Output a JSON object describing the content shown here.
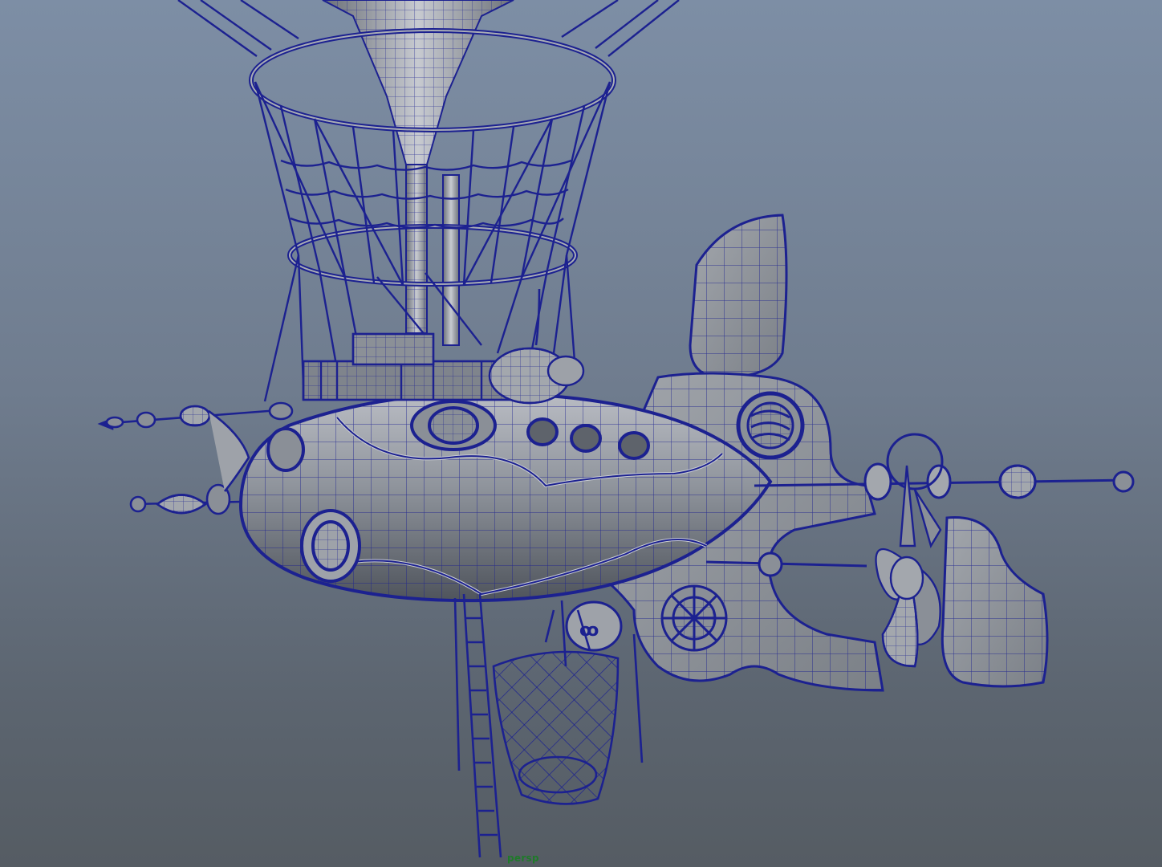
{
  "viewport": {
    "camera_label": "persp",
    "background_top": "#7d8ea5",
    "background_bottom": "#555c63",
    "wireframe_color": "#1c2190",
    "shaded_color": "#8a8f98",
    "camera_label_color": "#1f7a2a"
  },
  "model": {
    "name": "steampunk-airship-wireframe",
    "visible_parts": [
      "balloon-funnel",
      "rope-rings",
      "rigging-net",
      "hull",
      "portholes",
      "tail-fin",
      "propeller",
      "bowsprit-antennas",
      "cargo-net",
      "rope-ladder"
    ]
  }
}
